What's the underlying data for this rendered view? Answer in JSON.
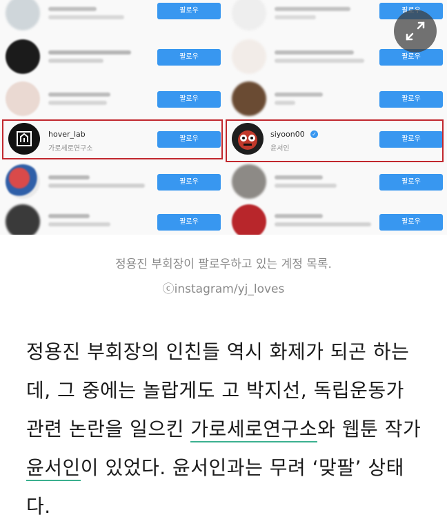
{
  "screenshot": {
    "follow_label": "팔로우",
    "left_highlight": {
      "username": "hover_lab",
      "display_name": "가로세로연구소"
    },
    "right_highlight": {
      "username": "siyoon00",
      "display_name": "윤서인"
    }
  },
  "caption": {
    "line1": "정용진 부회장이 팔로우하고 있는 계정 목록.",
    "line2": "ⓒinstagram/yj_loves"
  },
  "article": {
    "part1": "정용진 부회장의 인친들 역시 화제가 되곤 하는데, 그 중에는 놀랍게도 고 박지선, 독립운동가 관련 논란을 일으킨 ",
    "highlight1": "가로세로연구소",
    "part2": "와 웹툰 작가 ",
    "highlight2": "윤서인",
    "part3": "이 있었다. 윤서인과는 무려 ‘맞팔’ 상태다."
  },
  "colors": {
    "follow_button": "#3897f0",
    "highlight_box": "#c1272d",
    "underline": "#3bb08f"
  },
  "icons": {
    "expand": "expand-arrows-icon",
    "verified": "verified-badge-icon"
  }
}
